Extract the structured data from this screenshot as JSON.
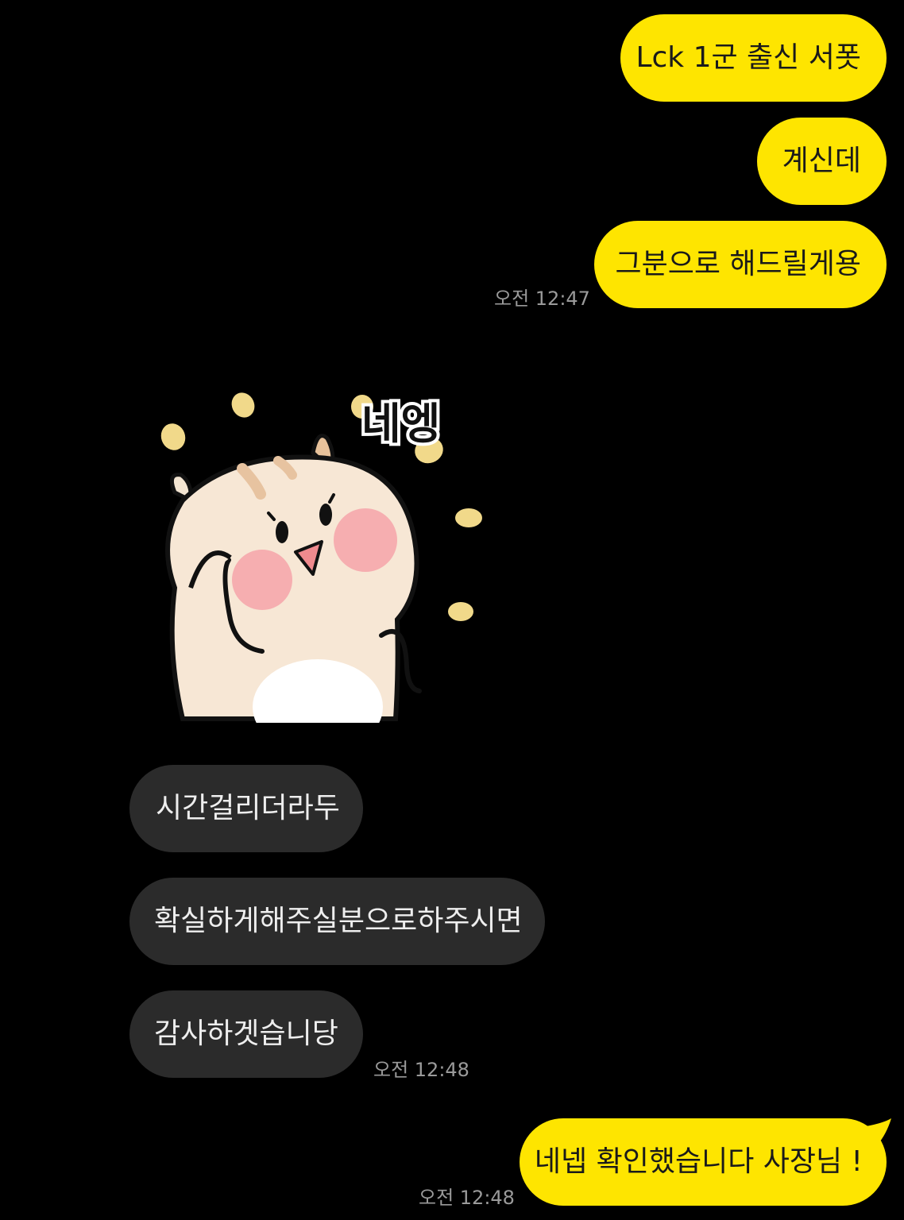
{
  "colors": {
    "background": "#000000",
    "my_bubble": "#FEE500",
    "their_bubble": "#2b2b2b",
    "timestamp": "#9a9a9a"
  },
  "messages": {
    "m1": "Lck 1군 출신 서폿",
    "m2": "계신데",
    "m3": "그분으로 해드릴게용",
    "ts1": "오전 12:47",
    "sticker_text": "네엥",
    "m4": "시간걸리더라두",
    "m5": "확실하게해주실분으로하주시면",
    "m6": "감사하겟습니당",
    "ts2": "오전 12:48",
    "m7": "네넵 확인했습니다 사장님 !",
    "ts3": "오전 12:48"
  }
}
